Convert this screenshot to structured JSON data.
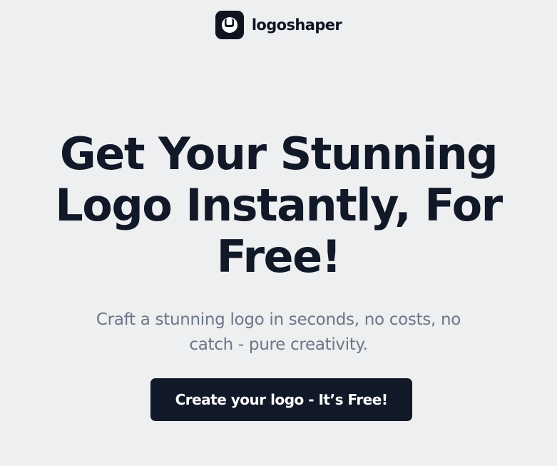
{
  "header": {
    "brand_name": "logoshaper",
    "logo_icon": "logoshaper-logo-icon"
  },
  "hero": {
    "title_lines": [
      "Get Your Stunning",
      "Logo Instantly, For",
      "Free!"
    ],
    "subtitle_lines": [
      "Craft a stunning logo in seconds, no costs, no",
      "catch - pure creativity."
    ],
    "cta_label": "Create your logo - It’s Free!"
  },
  "colors": {
    "background": "#eeeff1",
    "heading": "#111827",
    "subtitle": "#6b7687",
    "button_bg": "#111827",
    "button_text": "#ffffff"
  }
}
